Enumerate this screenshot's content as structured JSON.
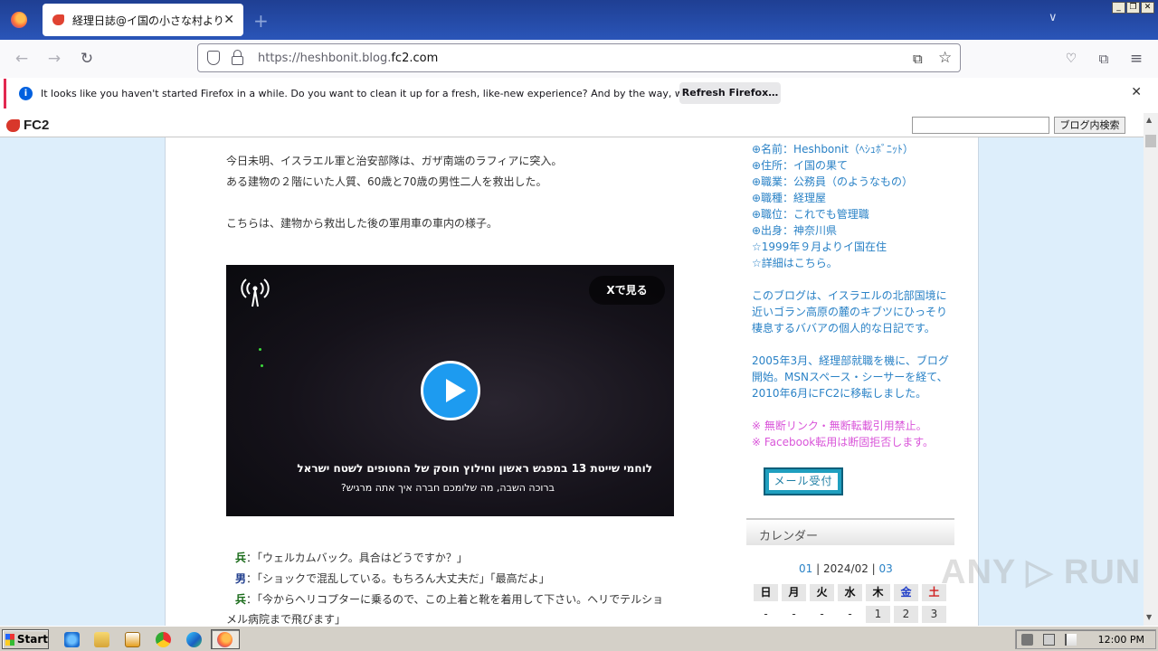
{
  "browser": {
    "tab_title": "経理日誌@イ国の小さな村より",
    "url_prefix": "https://heshbonit.blog.",
    "url_domain": "fc2.com",
    "notification_text": "It looks like you haven't started Firefox in a while. Do you want to clean it up for a fresh, like-new experience? And by the way, welcome back!",
    "notification_button": "Refresh Firefox…"
  },
  "fc2bar": {
    "logo": "FC2",
    "search_button": "ブログ内検索"
  },
  "article": {
    "para1_line1": "今日未明、イスラエル軍と治安部隊は、ガザ南端のラフィアに突入。",
    "para1_line2": "ある建物の２階にいた人質、60歳と70歳の男性二人を救出した。",
    "para2": "こちらは、建物から救出した後の軍用車の車内の様子。",
    "video": {
      "x_button": "Xで見る",
      "subtitle_1": "לוחמי שייטת 13 במפגש ראשון וחילוץ חוסק של החטופים לשטח ישראל",
      "subtitle_2": "ברוכה השבה, מה שלומכם חברה איך אתה מרגיש?"
    },
    "dialog": [
      {
        "speaker": "兵",
        "color": "g",
        "text": "：「ウェルカムバック。具合はどうですか？」"
      },
      {
        "speaker": "男",
        "color": "b",
        "text": "：「ショックで混乱している。もちろん大丈夫だ」「最高だよ」"
      },
      {
        "speaker": "兵",
        "color": "g",
        "text": "：「今からヘリコプターに乗るので、この上着と靴を着用して下さい。ヘリでテルショ"
      }
    ],
    "dialog_continuation": "メル病院まで飛びます」"
  },
  "sidebar": {
    "profile": [
      "⊕名前：Heshbonit（ﾍｼｭﾎﾞﾆｯﾄ）",
      "⊕住所：イ国の果て",
      "⊕職業：公務員（のようなもの）",
      "⊕職種：経理屋",
      "⊕職位：これでも管理職",
      "⊕出身：神奈川県",
      "☆1999年９月よりイ国在住",
      "☆詳細はこちら。"
    ],
    "about": [
      "このブログは、イスラエルの北部国境に",
      "近いゴラン高原の麓のキブツにひっそり",
      "棲息するババアの個人的な日記です。"
    ],
    "history": [
      "2005年3月、経理部就職を機に、ブログ",
      "開始。MSNスペース・シーサーを経て、",
      "2010年6月にFC2に移転しました。"
    ],
    "notices": [
      "※ 無断リンク・無断転載引用禁止。",
      "※ Facebook転用は断固拒否します。"
    ],
    "mail_button": "メール受付",
    "calendar": {
      "heading": "カレンダー",
      "prev": "01",
      "current": "2024/02",
      "next": "03",
      "sep": "|",
      "weekdays": [
        "日",
        "月",
        "火",
        "水",
        "木",
        "金",
        "土"
      ],
      "weekday_colors": [
        "#111111",
        "#111111",
        "#111111",
        "#111111",
        "#111111",
        "#1e3cc8",
        "#d02020"
      ],
      "first_row": [
        "-",
        "-",
        "-",
        "-",
        "1",
        "2",
        "3"
      ]
    }
  },
  "watermark": "ANY ▷ RUN",
  "taskbar": {
    "start_label": "Start",
    "time": "12:00 PM"
  }
}
